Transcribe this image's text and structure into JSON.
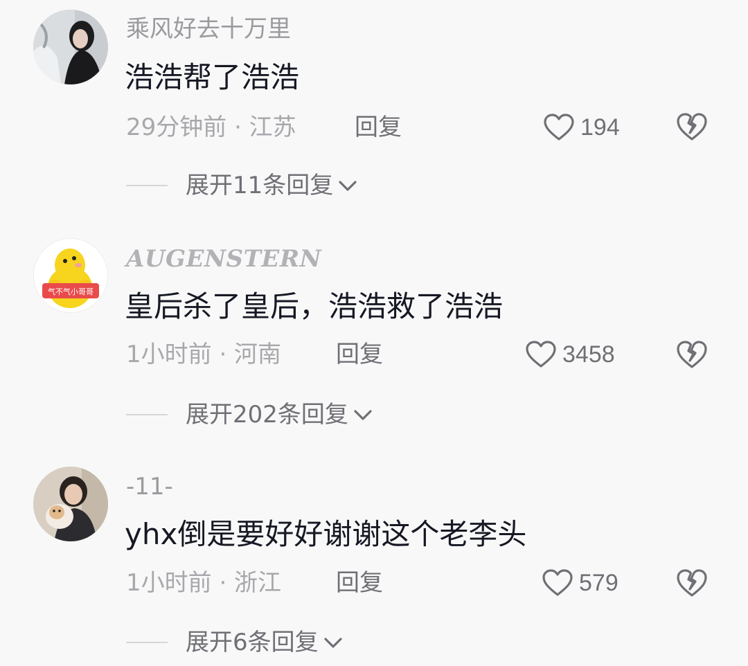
{
  "comments": [
    {
      "username": "乘风好去十万里",
      "text": "浩浩帮了浩浩",
      "time_location": "29分钟前 · 江苏",
      "reply_label": "回复",
      "likes": "194",
      "expand_label": "展开11条回复"
    },
    {
      "username": "AUGENSTERN",
      "text": "皇后杀了皇后，浩浩救了浩浩",
      "time_location": "1小时前 · 河南",
      "reply_label": "回复",
      "likes": "3458",
      "expand_label": "展开202条回复",
      "avatar_badge": "气不气小哥哥"
    },
    {
      "username": "-11-",
      "text": "yhx倒是要好好谢谢这个老李头",
      "time_location": "1小时前 · 浙江",
      "reply_label": "回复",
      "likes": "579",
      "expand_label": "展开6条回复"
    }
  ],
  "icons": {
    "like": "heart-outline-icon",
    "dislike": "broken-heart-icon",
    "expand": "chevron-down-icon"
  },
  "colors": {
    "background": "#f8f8f8",
    "text_primary": "#161823",
    "text_secondary": "#a8a8ac",
    "action": "#6f6f75"
  }
}
